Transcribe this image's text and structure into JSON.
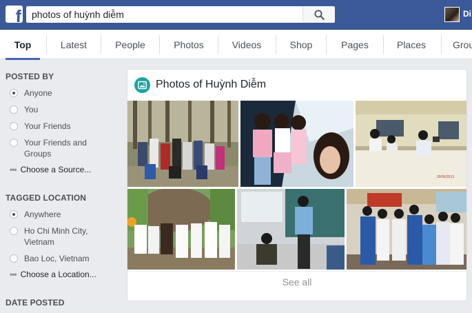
{
  "search": {
    "query": "photos of huỳnh diễm"
  },
  "header": {
    "user_name": "Di"
  },
  "tabs": [
    "Top",
    "Latest",
    "People",
    "Photos",
    "Videos",
    "Shop",
    "Pages",
    "Places",
    "Grou"
  ],
  "filters": {
    "posted_by": {
      "title": "POSTED BY",
      "options": [
        "Anyone",
        "You",
        "Your Friends",
        "Your Friends and Groups"
      ],
      "more": "Choose a Source..."
    },
    "tagged_location": {
      "title": "TAGGED LOCATION",
      "options": [
        "Anywhere",
        "Ho Chi Minh City, Vietnam",
        "Bao Loc, Vietnam"
      ],
      "more": "Choose a Location..."
    },
    "date_posted": {
      "title": "DATE POSTED"
    }
  },
  "results": {
    "title": "Photos of Huỳnh Diễm",
    "see_all": "See all",
    "photo_dates": [
      "20/06/2013"
    ]
  },
  "colors": {
    "brand_blue": "#3b5998",
    "accent_blue": "#4267b2",
    "photo_icon": "#1ba3a1"
  }
}
